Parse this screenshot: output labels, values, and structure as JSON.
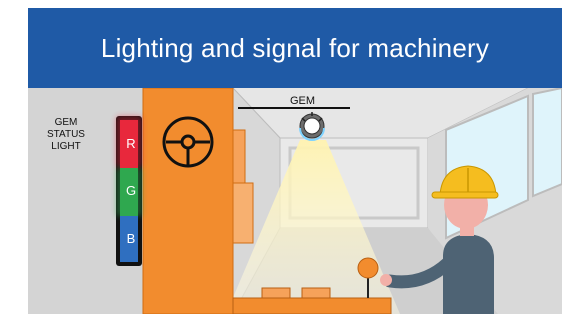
{
  "header": {
    "title": "Lighting and signal for machinery"
  },
  "status_light": {
    "label": "GEM\nSTATUS\nLIGHT",
    "segments": [
      {
        "letter": "R",
        "color": "#e8283c"
      },
      {
        "letter": "G",
        "color": "#2fa84f"
      },
      {
        "letter": "B",
        "color": "#2f6fc0"
      }
    ]
  },
  "lamp": {
    "label": "GEM"
  },
  "colors": {
    "banner": "#1f5aa6",
    "machine": "#f28c2e",
    "helmet": "#f5bd1f",
    "shirt": "#4e6374",
    "skin": "#f2b0a8"
  }
}
